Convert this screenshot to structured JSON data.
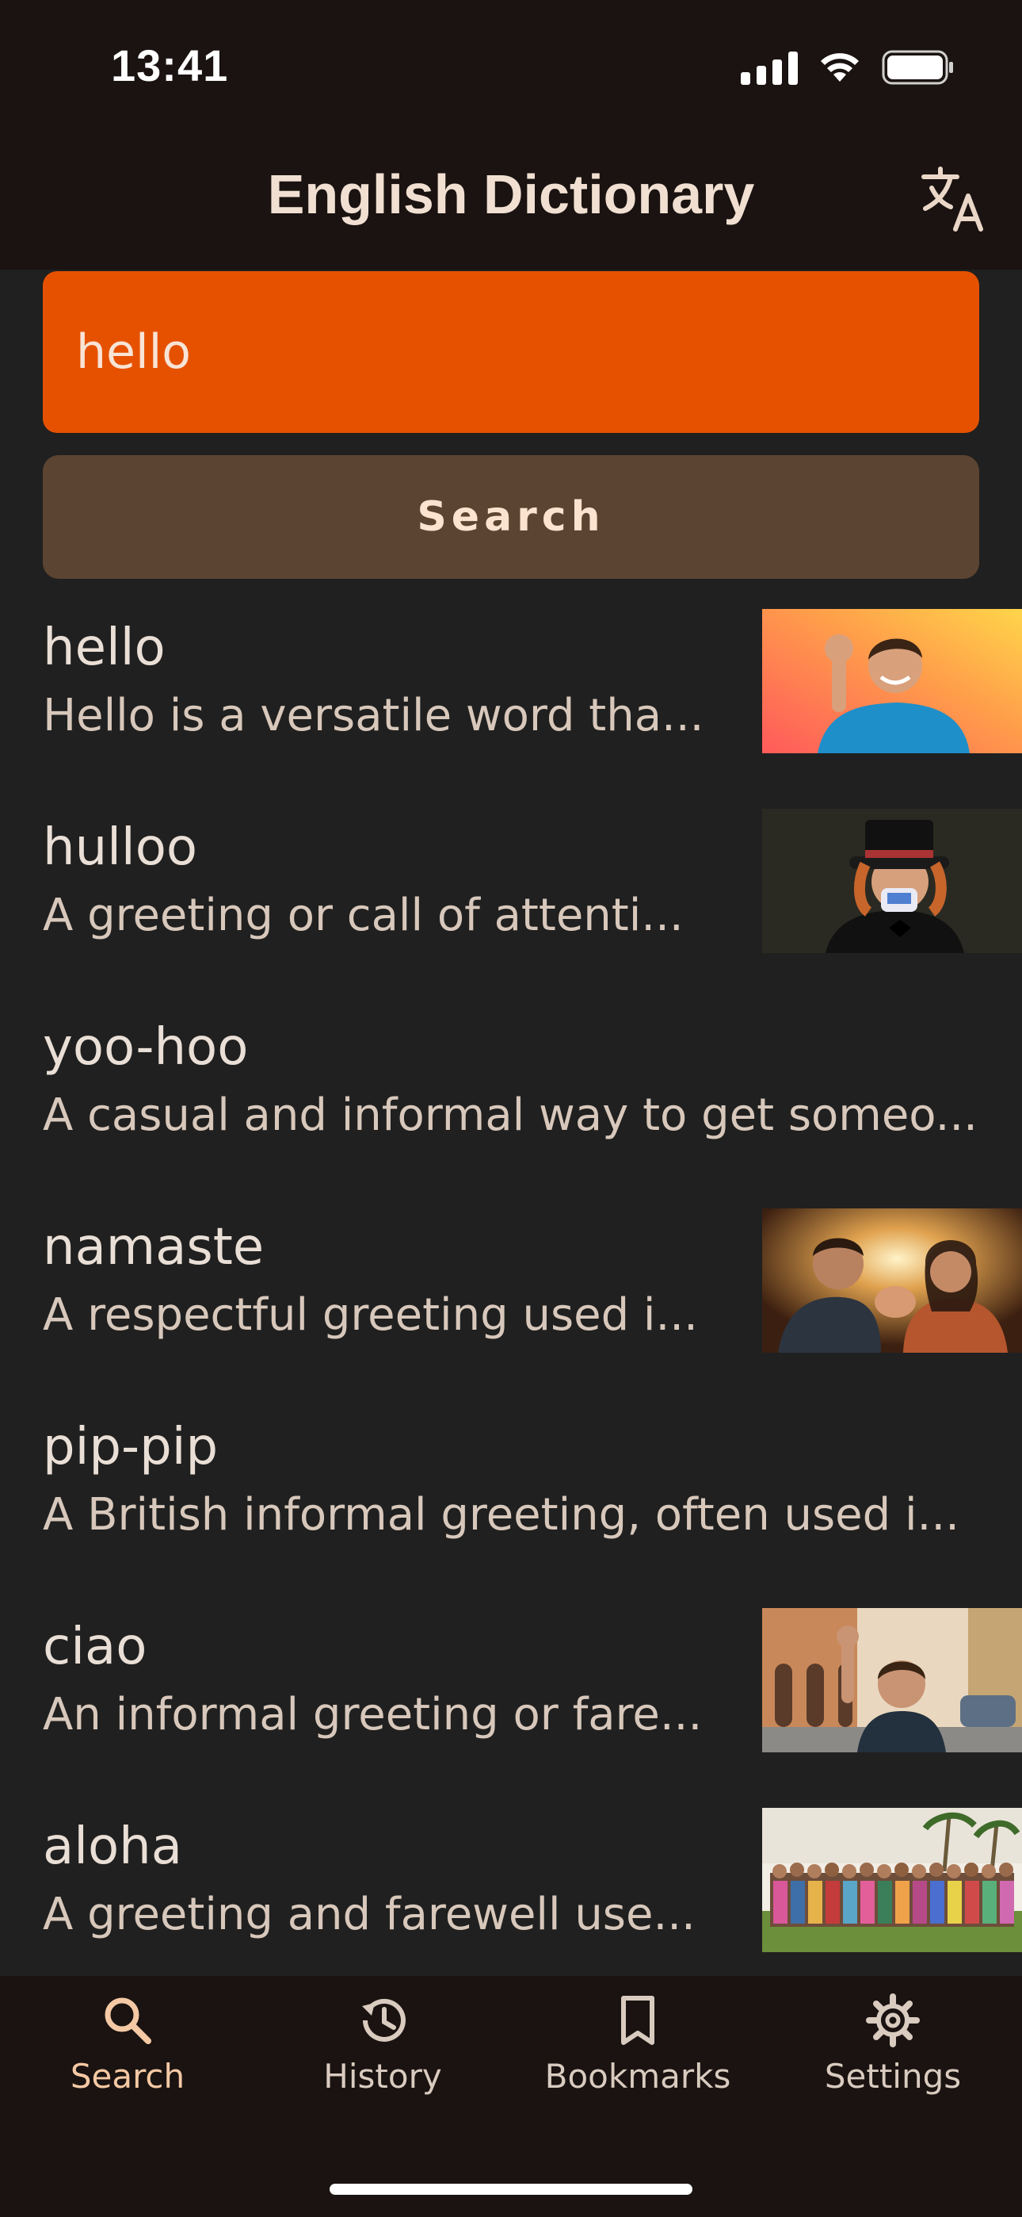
{
  "status_bar": {
    "time": "13:41"
  },
  "header": {
    "title": "English Dictionary",
    "translate_icon": "translate-icon"
  },
  "search": {
    "value": "hello",
    "button_label": "Search"
  },
  "results": [
    {
      "word": "hello",
      "definition": "Hello is a versatile word tha...",
      "has_image": true
    },
    {
      "word": "hulloo",
      "definition": "A greeting or call of attenti...",
      "has_image": true
    },
    {
      "word": "yoo-hoo",
      "definition": "A casual and informal way to get someo...",
      "has_image": false
    },
    {
      "word": "namaste",
      "definition": "A respectful greeting used i...",
      "has_image": true
    },
    {
      "word": "pip-pip",
      "definition": "A British informal greeting, often used i...",
      "has_image": false
    },
    {
      "word": "ciao",
      "definition": "An informal greeting or fare...",
      "has_image": true
    },
    {
      "word": "aloha",
      "definition": "A greeting and farewell use...",
      "has_image": true
    }
  ],
  "bottom_nav": {
    "items": [
      {
        "label": "Search",
        "icon": "search-icon",
        "active": true
      },
      {
        "label": "History",
        "icon": "history-icon",
        "active": false
      },
      {
        "label": "Bookmarks",
        "icon": "bookmark-icon",
        "active": false
      },
      {
        "label": "Settings",
        "icon": "gear-icon",
        "active": false
      }
    ]
  },
  "colors": {
    "background": "#202020",
    "header_bg": "#1a1311",
    "search_field": "#e65100",
    "search_button": "#5b4431",
    "active_nav": "#f5c9a4"
  }
}
